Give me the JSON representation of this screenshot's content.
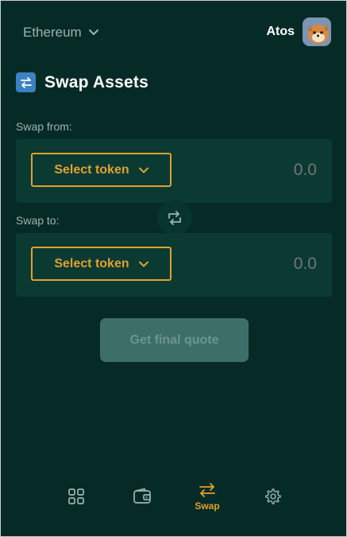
{
  "header": {
    "network": "Ethereum",
    "account_name": "Atos"
  },
  "page": {
    "title": "Swap Assets"
  },
  "swap_from": {
    "label": "Swap from:",
    "token_button": "Select token",
    "amount": "0.0"
  },
  "swap_to": {
    "label": "Swap to:",
    "token_button": "Select token",
    "amount": "0.0"
  },
  "quote_button": "Get final quote",
  "nav": {
    "items": [
      {
        "icon": "dashboard-grid-icon",
        "label": "",
        "active": false
      },
      {
        "icon": "wallet-icon",
        "label": "",
        "active": false
      },
      {
        "icon": "swap-icon",
        "label": "Swap",
        "active": true
      },
      {
        "icon": "gear-icon",
        "label": "",
        "active": false
      }
    ]
  },
  "colors": {
    "background": "#062b26",
    "card": "#0b3a33",
    "accent": "#e1a12f",
    "muted_text": "#9db3ae",
    "disabled_button": "#3d6f68",
    "title_icon": "#3b82c4"
  }
}
